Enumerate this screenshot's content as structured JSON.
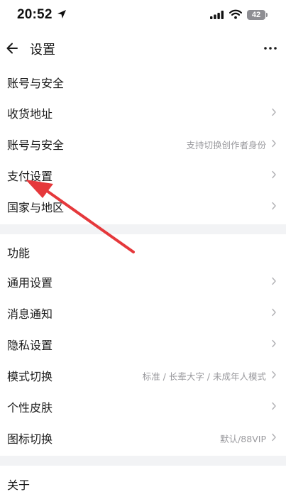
{
  "status_bar": {
    "time": "20:52",
    "battery": "42"
  },
  "nav": {
    "title": "设置"
  },
  "sections": [
    {
      "header": "账号与安全",
      "rows": [
        {
          "label": "收货地址",
          "value": ""
        },
        {
          "label": "账号与安全",
          "value": "支持切换创作者身份"
        },
        {
          "label": "支付设置",
          "value": ""
        },
        {
          "label": "国家与地区",
          "value": ""
        }
      ]
    },
    {
      "header": "功能",
      "rows": [
        {
          "label": "通用设置",
          "value": ""
        },
        {
          "label": "消息通知",
          "value": ""
        },
        {
          "label": "隐私设置",
          "value": ""
        },
        {
          "label": "模式切换",
          "value": "标准 / 长辈大字 / 未成年人模式"
        },
        {
          "label": "个性皮肤",
          "value": ""
        },
        {
          "label": "图标切换",
          "value": "默认/88VIP"
        }
      ]
    },
    {
      "header": "关于",
      "rows": []
    }
  ],
  "icons": {
    "back": "arrow-left",
    "more": "ellipsis",
    "row_chevron": "chevron-right",
    "location": "location-arrow",
    "signal": "cellular-signal",
    "wifi": "wifi"
  },
  "colors": {
    "annotation_arrow": "#e5383b",
    "secondary_text": "#9a9a9e",
    "page_background": "#f2f3f5"
  }
}
